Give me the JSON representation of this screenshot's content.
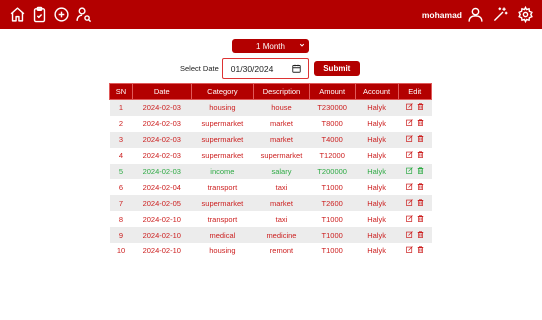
{
  "header": {
    "username": "mohamad",
    "icons": [
      "home-icon",
      "clipboard-icon",
      "add-circle-icon",
      "user-search-icon",
      "user-icon",
      "magic-wand-icon",
      "gear-icon"
    ]
  },
  "filter": {
    "selected": "1 Month"
  },
  "date": {
    "label": "Select Date",
    "value": "01/30/2024"
  },
  "submit_label": "Submit",
  "table": {
    "headers": [
      "SN",
      "Date",
      "Category",
      "Description",
      "Amount",
      "Account",
      "Edit"
    ],
    "rows": [
      {
        "sn": "1",
        "date": "2024-02-03",
        "category": "housing",
        "description": "house",
        "amount": "T230000",
        "account": "Halyk",
        "type": "expense"
      },
      {
        "sn": "2",
        "date": "2024-02-03",
        "category": "supermarket",
        "description": "market",
        "amount": "T8000",
        "account": "Halyk",
        "type": "expense"
      },
      {
        "sn": "3",
        "date": "2024-02-03",
        "category": "supermarket",
        "description": "market",
        "amount": "T4000",
        "account": "Halyk",
        "type": "expense"
      },
      {
        "sn": "4",
        "date": "2024-02-03",
        "category": "supermarket",
        "description": "supermarket",
        "amount": "T12000",
        "account": "Halyk",
        "type": "expense"
      },
      {
        "sn": "5",
        "date": "2024-02-03",
        "category": "income",
        "description": "salary",
        "amount": "T200000",
        "account": "Halyk",
        "type": "income"
      },
      {
        "sn": "6",
        "date": "2024-02-04",
        "category": "transport",
        "description": "taxi",
        "amount": "T1000",
        "account": "Halyk",
        "type": "expense"
      },
      {
        "sn": "7",
        "date": "2024-02-05",
        "category": "supermarket",
        "description": "market",
        "amount": "T2600",
        "account": "Halyk",
        "type": "expense"
      },
      {
        "sn": "8",
        "date": "2024-02-10",
        "category": "transport",
        "description": "taxi",
        "amount": "T1000",
        "account": "Halyk",
        "type": "expense"
      },
      {
        "sn": "9",
        "date": "2024-02-10",
        "category": "medical",
        "description": "medicine",
        "amount": "T1000",
        "account": "Halyk",
        "type": "expense"
      },
      {
        "sn": "10",
        "date": "2024-02-10",
        "category": "housing",
        "description": "remont",
        "amount": "T1000",
        "account": "Halyk",
        "type": "expense"
      }
    ]
  },
  "colors": {
    "brand": "#b30000",
    "expense_text": "#cc1f1f",
    "income_text": "#2eaa44",
    "row_stripe": "#ececec"
  }
}
